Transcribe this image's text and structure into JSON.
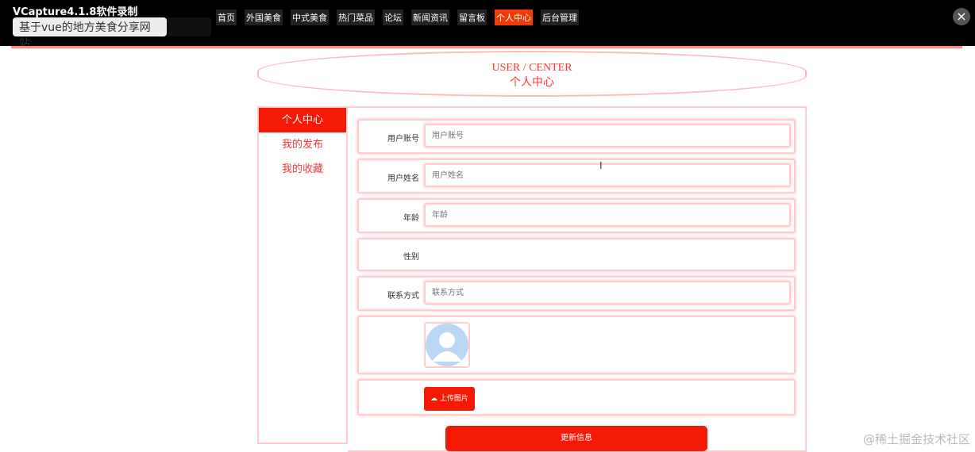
{
  "recorder": "VCapture4.1.8软件录制",
  "site_title": "基于vue的地方美食分享网站",
  "nav": [
    "首页",
    "外国美食",
    "中式美食",
    "热门菜品",
    "论坛",
    "新闻资讯",
    "留言板",
    "个人中心",
    "后台管理"
  ],
  "header": {
    "en": "USER / CENTER",
    "cn": "个人中心"
  },
  "sidebar": [
    "个人中心",
    "我的发布",
    "我的收藏"
  ],
  "form": {
    "username": {
      "label": "用户账号",
      "placeholder": "用户账号"
    },
    "name": {
      "label": "用户姓名",
      "placeholder": "用户姓名"
    },
    "age": {
      "label": "年龄",
      "placeholder": "年龄"
    },
    "gender": {
      "label": "性别"
    },
    "phone": {
      "label": "联系方式",
      "placeholder": "联系方式"
    },
    "upload": "上传图片",
    "submit": "更新信息"
  },
  "watermark": "@稀土掘金技术社区",
  "colors": {
    "accent": "#f51a05",
    "nav": "#f25a05"
  }
}
